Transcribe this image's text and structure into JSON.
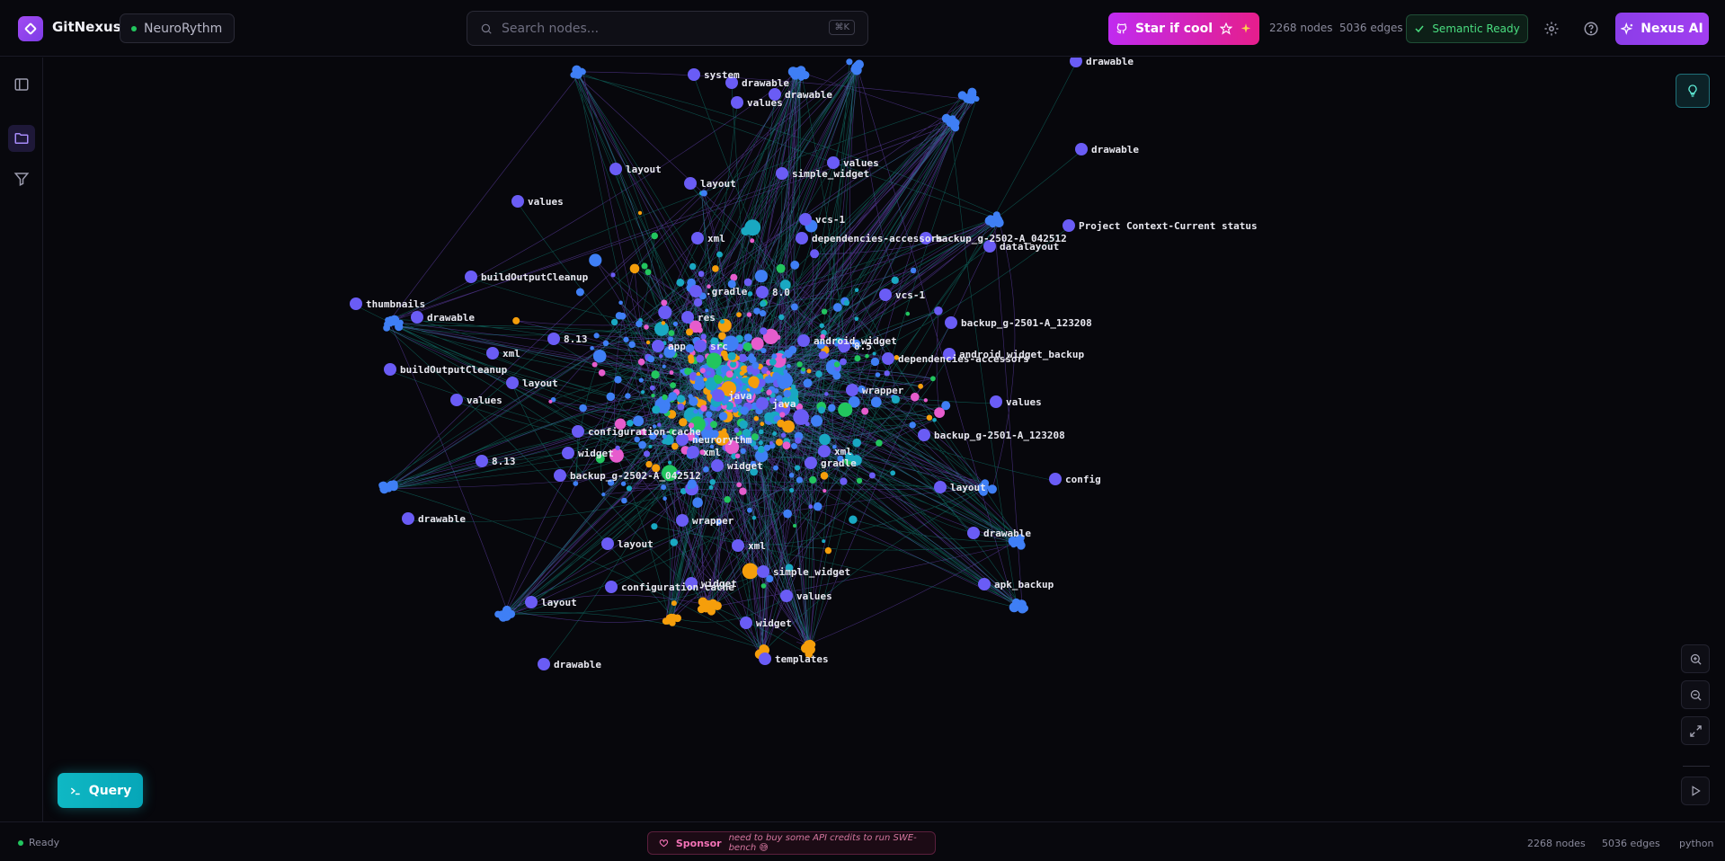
{
  "header": {
    "brand": "GitNexus",
    "project": "NeuroRythm",
    "search_placeholder": "Search nodes...",
    "search_shortcut": "⌘K",
    "star_label": "Star if cool",
    "nodes_count": "2268 nodes",
    "edges_count": "5036 edges",
    "semantic_status": "Semantic Ready",
    "nexus_ai_label": "Nexus AI"
  },
  "query": {
    "label": "Query"
  },
  "footer": {
    "status": "Ready",
    "sponsor_label": "Sponsor",
    "sponsor_message": "need to buy some API credits to run SWE-bench 😅",
    "nodes_count": "2268 nodes",
    "edges_count": "5036 edges",
    "language": "python"
  },
  "colors": {
    "folder": "#6a5cf5",
    "file": "#3f7ff5",
    "class": "#e65ccd",
    "function": "#19a8c2",
    "method": "#22c55e",
    "module": "#f59e0b",
    "edge_contains": "#8b5cf6",
    "edge_imports": "#14b8a6"
  },
  "graph": {
    "labels": [
      "drawable",
      "system",
      "drawable",
      "values",
      "drawable",
      "drawable",
      "layout",
      "layout",
      "simple_widget",
      "values",
      "values",
      "vcs-1",
      "xml",
      "dependencies-accessors",
      "backup_g-2502-A_042512",
      "datalayout",
      "Project Context-Current status",
      "buildOutputCleanup",
      ".gradle",
      "8.0",
      "vcs-1",
      "thumbnails",
      "drawable",
      "res",
      "backup_g-2501-A_123208",
      "8.13",
      "xml",
      "app",
      "src",
      "android_widget",
      "android_widget_backup",
      "8.5",
      "dependencies-accessors",
      "buildOutputCleanup",
      "layout",
      "wrapper",
      "values",
      "java",
      "java",
      "values",
      "configuration-cache",
      "neurorythm",
      "backup_g-2501-A_123208",
      "widget",
      "xml",
      "xml",
      "8.13",
      "gradle",
      "widget",
      "backup_g-2502-A_042512",
      "config",
      "layout",
      "drawable",
      "drawable",
      "wrapper",
      "layout",
      "xml",
      "simple_widget",
      "widget",
      "configuration-cache",
      "apk_backup",
      "values",
      "layout",
      "widget",
      "templates",
      "drawable"
    ]
  }
}
